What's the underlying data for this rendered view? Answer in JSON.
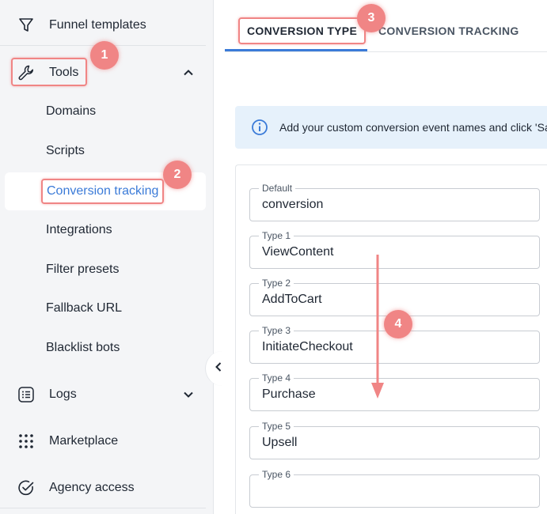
{
  "sidebar": {
    "funnel_templates": "Funnel templates",
    "tools": "Tools",
    "sub_items": [
      "Domains",
      "Scripts",
      "Conversion tracking",
      "Integrations",
      "Filter presets",
      "Fallback URL",
      "Blacklist bots"
    ],
    "logs": "Logs",
    "marketplace": "Marketplace",
    "agency_access": "Agency access"
  },
  "tabs": {
    "conversion_type": "CONVERSION TYPE",
    "conversion_tracking": "CONVERSION TRACKING"
  },
  "info": {
    "text": "Add your custom conversion event names and click 'Sa"
  },
  "fields": [
    {
      "label": "Default",
      "value": "conversion"
    },
    {
      "label": "Type 1",
      "value": "ViewContent"
    },
    {
      "label": "Type 2",
      "value": "AddToCart"
    },
    {
      "label": "Type 3",
      "value": "InitiateCheckout"
    },
    {
      "label": "Type 4",
      "value": "Purchase"
    },
    {
      "label": "Type 5",
      "value": "Upsell"
    },
    {
      "label": "Type 6",
      "value": ""
    }
  ],
  "callouts": [
    "1",
    "2",
    "3",
    "4"
  ],
  "colors": {
    "accent": "#3b7bd8",
    "highlight": "#f08585",
    "info_bg": "#e6f1fb"
  }
}
